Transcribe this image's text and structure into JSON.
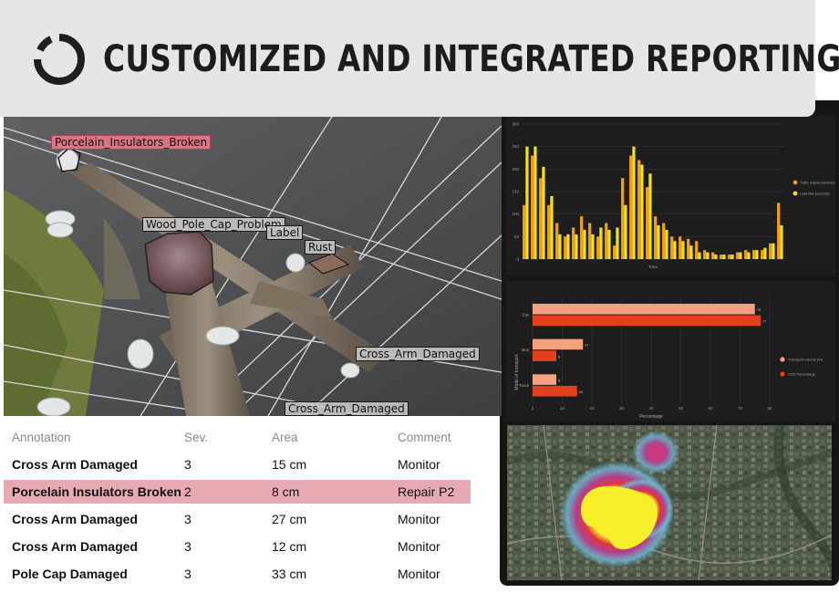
{
  "header": {
    "title": "CUSTOMIZED AND INTEGRATED REPORTING",
    "logo_icon": "ring-logo-icon"
  },
  "annotations": [
    {
      "label": "Porcelain_Insulators_Broken",
      "style": "danger"
    },
    {
      "label": "Wood_Pole_Cap_Problem",
      "style": "normal"
    },
    {
      "label": "Label",
      "style": "normal"
    },
    {
      "label": "Rust",
      "style": "normal"
    },
    {
      "label": "Cross_Arm_Damaged",
      "style": "normal"
    },
    {
      "label": "Cross_Arm_Damaged",
      "style": "normal"
    }
  ],
  "table": {
    "columns": [
      "Annotation",
      "Sev.",
      "Area",
      "Comment"
    ],
    "rows": [
      {
        "annotation": "Cross Arm Damaged",
        "sev": "3",
        "area": "15 cm",
        "comment": "Monitor",
        "highlight": false
      },
      {
        "annotation": "Porcelain Insulators Broken",
        "sev": "2",
        "area": "8 cm",
        "comment": "Repair P2",
        "highlight": true
      },
      {
        "annotation": "Cross Arm Damaged",
        "sev": "3",
        "area": "27 cm",
        "comment": "Monitor",
        "highlight": false
      },
      {
        "annotation": "Cross Arm Damaged",
        "sev": "3",
        "area": "12 cm",
        "comment": "Monitor",
        "highlight": false
      },
      {
        "annotation": "Pole Cap Damaged",
        "sev": "3",
        "area": "33 cm",
        "comment": "Monitor",
        "highlight": false
      }
    ]
  },
  "colors": {
    "highlight_row": "#e8aab2",
    "series_orange": "#f39c1e",
    "series_yellow": "#f2e21a",
    "bar_light": "#f5a07e",
    "bar_dark": "#e2401d"
  },
  "chart_data": [
    {
      "type": "bar",
      "title": "",
      "xlabel": "Time",
      "ylabel": "",
      "ylim": [
        0,
        300
      ],
      "yticks": [
        "300",
        "250",
        "200",
        "150",
        "100",
        "50",
        "0"
      ],
      "grid": true,
      "legend_position": "right",
      "series": [
        {
          "name": "Traffic volume (vehicles)",
          "values": [
            120,
            230,
            180,
            120,
            80,
            50,
            70,
            95,
            80,
            50,
            80,
            30,
            180,
            230,
            220,
            160,
            95,
            80,
            50,
            50,
            45,
            40,
            20,
            15,
            10,
            10,
            15,
            20,
            20,
            20,
            35,
            125
          ]
        },
        {
          "name": "Load time (seconds)",
          "values": [
            250,
            250,
            205,
            140,
            55,
            55,
            55,
            65,
            55,
            70,
            65,
            70,
            120,
            250,
            210,
            190,
            75,
            65,
            40,
            40,
            30,
            15,
            15,
            10,
            10,
            10,
            15,
            15,
            20,
            25,
            35,
            75
          ]
        }
      ]
    },
    {
      "type": "bar",
      "orientation": "horizontal",
      "title": "",
      "xlabel": "Percentage",
      "ylabel": "Mode of transport",
      "categories": [
        "Car",
        "Bus",
        "Truck"
      ],
      "xlim": [
        0,
        80
      ],
      "xticks": [
        "0",
        "10",
        "20",
        "30",
        "40",
        "50",
        "60",
        "70",
        "80"
      ],
      "grid": true,
      "legend_position": "right",
      "series": [
        {
          "name": "Transport volume (%)",
          "values": [
            75,
            17,
            8
          ]
        },
        {
          "name": "CO2 Percentage",
          "values": [
            77,
            8,
            15
          ]
        }
      ]
    }
  ]
}
